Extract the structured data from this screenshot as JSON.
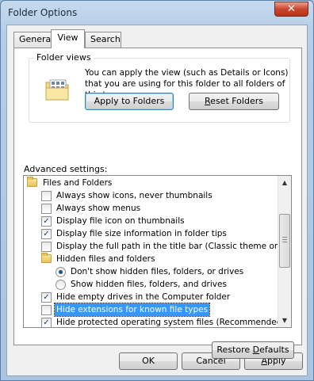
{
  "window": {
    "title": "Folder Options",
    "close_label": "✕"
  },
  "tabs": [
    {
      "label": "General"
    },
    {
      "label": "View"
    },
    {
      "label": "Search"
    }
  ],
  "folder_views": {
    "legend": "Folder views",
    "description": "You can apply the view (such as Details or Icons) that you are using for this folder to all folders of this type.",
    "apply_button": "Apply to Folders",
    "reset_button_prefix": "",
    "reset_button_mnemonic": "R",
    "reset_button_rest": "eset Folders"
  },
  "advanced": {
    "label": "Advanced settings:",
    "items": [
      {
        "type": "folder",
        "label": "Files and Folders"
      },
      {
        "type": "checkbox",
        "checked": false,
        "label": "Always show icons, never thumbnails"
      },
      {
        "type": "checkbox",
        "checked": false,
        "label": "Always show menus"
      },
      {
        "type": "checkbox",
        "checked": true,
        "label": "Display file icon on thumbnails"
      },
      {
        "type": "checkbox",
        "checked": true,
        "label": "Display file size information in folder tips"
      },
      {
        "type": "checkbox",
        "checked": false,
        "label": "Display the full path in the title bar (Classic theme only)"
      },
      {
        "type": "folder",
        "label": "Hidden files and folders"
      },
      {
        "type": "radio",
        "checked": true,
        "label": "Don't show hidden files, folders, or drives"
      },
      {
        "type": "radio",
        "checked": false,
        "label": "Show hidden files, folders, and drives"
      },
      {
        "type": "checkbox",
        "checked": true,
        "label": "Hide empty drives in the Computer folder"
      },
      {
        "type": "checkbox",
        "checked": false,
        "label": "Hide extensions for known file types",
        "selected": true
      },
      {
        "type": "checkbox",
        "checked": true,
        "label": "Hide protected operating system files (Recommended)"
      }
    ],
    "restore_prefix": "Restore ",
    "restore_mnemonic": "D",
    "restore_rest": "efaults"
  },
  "footer": {
    "ok": "OK",
    "cancel": "Cancel",
    "apply_mnemonic": "A",
    "apply_rest": "pply"
  }
}
